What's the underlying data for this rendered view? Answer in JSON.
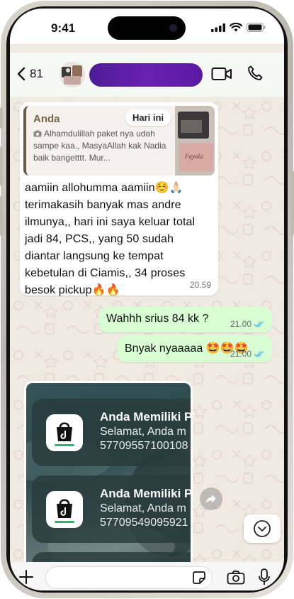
{
  "status_bar": {
    "time": "9:41"
  },
  "header": {
    "back_count": "81"
  },
  "messages": {
    "incoming": {
      "quote_author": "Anda",
      "quote_badge": "Hari ini",
      "quote_text": "Alhamdulillah paket nya udah sampe kaa., MasyaAllah kak Nadia baik bangetttt. Mur...",
      "thumb_label": "Fayola",
      "text": "aamiin allohumma aamiin☺️🙏🏻 terimakasih banyak mas andre ilmunya,, hari ini saya keluar total jadi 84, PCS,, yang 50 sudah diantar langsung ke tempat kebetulan di Ciamis,, 34 proses besok pickup🔥🔥",
      "time": "20.59"
    },
    "outgoing": [
      {
        "text": "Wahhh srius 84 kk ?",
        "time": "21.00"
      },
      {
        "text": "Bnyak nyaaaaa 🤩🤩🤩",
        "time": "21.00"
      }
    ],
    "image_notifications": [
      {
        "title": "Anda Memiliki P",
        "line1": "Selamat, Anda m",
        "line2": "57709557100108"
      },
      {
        "title": "Anda Memiliki P",
        "line1": "Selamat, Anda m",
        "line2": "57709549095921"
      }
    ]
  },
  "colors": {
    "outgoing_bubble": "#d9fdd3",
    "read_ticks": "#53bdeb",
    "name_pill": "#5a1aa3"
  }
}
